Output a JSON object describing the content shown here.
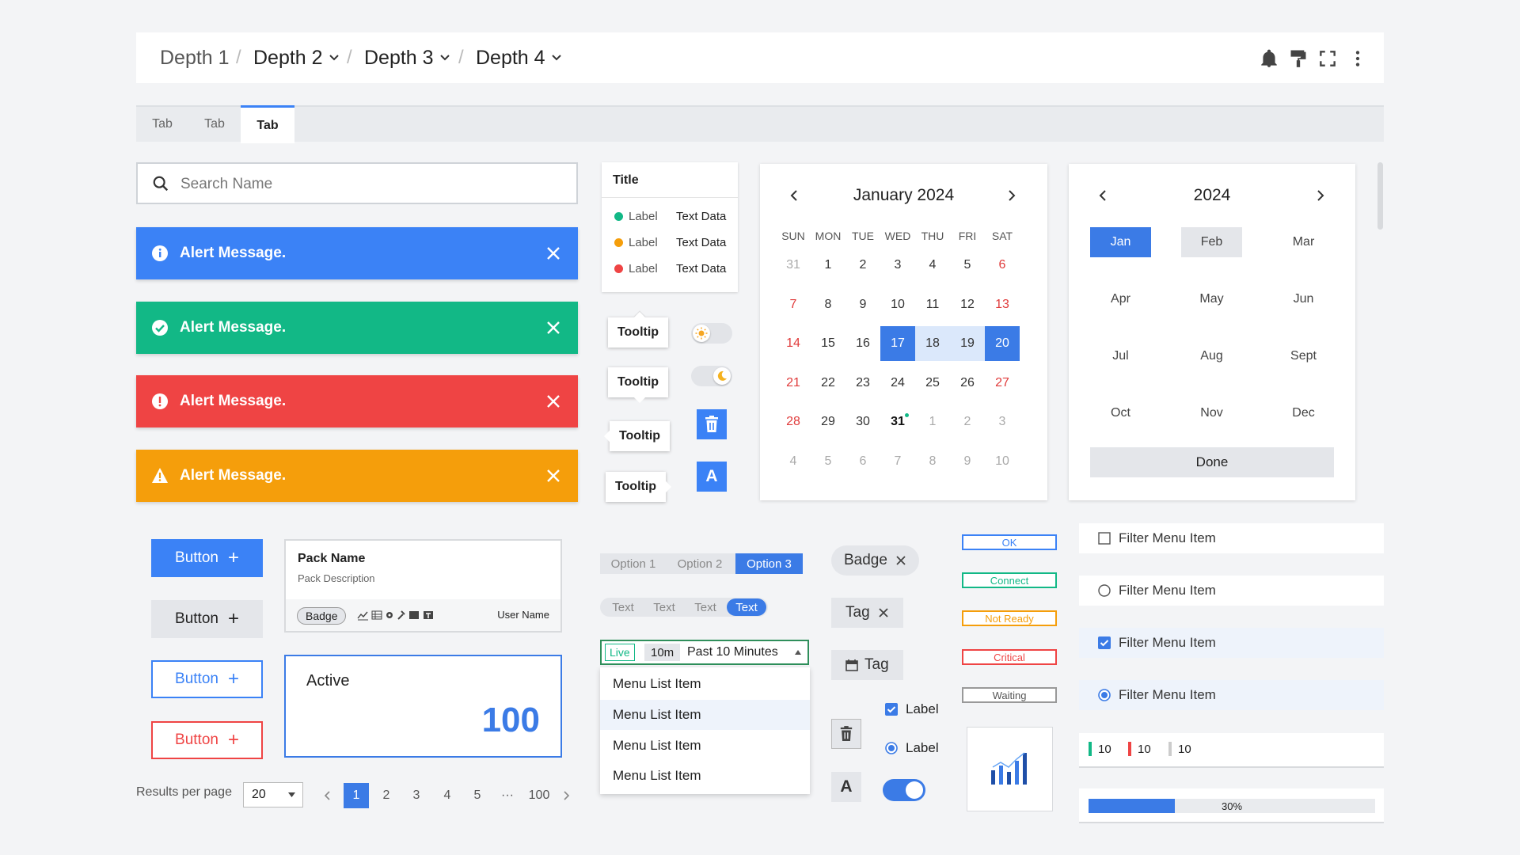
{
  "breadcrumb": {
    "items": [
      "Depth 1",
      "Depth 2",
      "Depth 3",
      "Depth 4"
    ],
    "separator": "/"
  },
  "header_icons": [
    "bell-icon",
    "paint-roller-icon",
    "fullscreen-icon",
    "more-vertical-icon"
  ],
  "tabs": [
    "Tab",
    "Tab",
    "Tab"
  ],
  "search": {
    "placeholder": "Search Name",
    "value": ""
  },
  "alerts": [
    {
      "text": "Alert Message.",
      "type": "info",
      "color": "#3b82f6"
    },
    {
      "text": "Alert Message.",
      "type": "success",
      "color": "#12b886"
    },
    {
      "text": "Alert Message.",
      "type": "error",
      "color": "#ef4444"
    },
    {
      "text": "Alert Message.",
      "type": "warning",
      "color": "#f59e0b"
    }
  ],
  "legend": {
    "title": "Title",
    "rows": [
      {
        "label": "Label",
        "value": "Text Data",
        "color": "#12b886"
      },
      {
        "label": "Label",
        "value": "Text Data",
        "color": "#f59e0b"
      },
      {
        "label": "Label",
        "value": "Text Data",
        "color": "#ef4444"
      }
    ]
  },
  "tooltips": [
    "Tooltip",
    "Tooltip",
    "Tooltip",
    "Tooltip"
  ],
  "icon_buttons": {
    "font_letter": "A"
  },
  "calendar": {
    "title": "January 2024",
    "weekdays": [
      "SUN",
      "MON",
      "TUE",
      "WED",
      "THU",
      "FRI",
      "SAT"
    ],
    "weeks": [
      [
        "31",
        "1",
        "2",
        "3",
        "4",
        "5",
        "6"
      ],
      [
        "7",
        "8",
        "9",
        "10",
        "11",
        "12",
        "13"
      ],
      [
        "14",
        "15",
        "16",
        "17",
        "18",
        "19",
        "20"
      ],
      [
        "21",
        "22",
        "23",
        "24",
        "25",
        "26",
        "27"
      ],
      [
        "28",
        "29",
        "30",
        "31",
        "1",
        "2",
        "3"
      ],
      [
        "4",
        "5",
        "6",
        "7",
        "8",
        "9",
        "10"
      ]
    ],
    "range_start": "17",
    "range_end": "20",
    "today": "31"
  },
  "month_picker": {
    "year": "2024",
    "months": [
      "Jan",
      "Feb",
      "Mar",
      "Apr",
      "May",
      "Jun",
      "Jul",
      "Aug",
      "Sept",
      "Oct",
      "Nov",
      "Dec"
    ],
    "selected": "Jan",
    "hovered": "Feb",
    "done_label": "Done"
  },
  "buttons": [
    "Button",
    "Button",
    "Button",
    "Button"
  ],
  "pack": {
    "name": "Pack Name",
    "description": "Pack Description",
    "badge": "Badge",
    "user": "User Name"
  },
  "active_card": {
    "label": "Active",
    "value": "100"
  },
  "pagination": {
    "results_label": "Results per page",
    "per_page": "20",
    "pages": [
      "1",
      "2",
      "3",
      "4",
      "5",
      "···",
      "100"
    ],
    "current": "1"
  },
  "segmented_options": {
    "items": [
      "Option 1",
      "Option 2",
      "Option 3"
    ],
    "selected": "Option 3"
  },
  "segmented_text": {
    "items": [
      "Text",
      "Text",
      "Text",
      "Text"
    ],
    "selected_index": 3
  },
  "time_select": {
    "live": "Live",
    "range": "10m",
    "label": "Past 10 Minutes"
  },
  "menu_items": [
    "Menu List Item",
    "Menu List Item",
    "Menu List Item",
    "Menu List Item"
  ],
  "chips": {
    "badge": "Badge",
    "tag": "Tag",
    "date_tag": "Tag"
  },
  "checks": {
    "checkbox_label": "Label",
    "radio_label": "Label"
  },
  "statuses": [
    {
      "text": "OK",
      "color": "#3b82f6"
    },
    {
      "text": "Connect",
      "color": "#12b886"
    },
    {
      "text": "Not Ready",
      "color": "#f59e0b"
    },
    {
      "text": "Critical",
      "color": "#ef4444"
    },
    {
      "text": "Waiting",
      "color": "#888888"
    }
  ],
  "filter_items": [
    {
      "label": "Filter Menu Item",
      "control": "checkbox",
      "checked": false
    },
    {
      "label": "Filter Menu Item",
      "control": "radio",
      "checked": false
    },
    {
      "label": "Filter Menu Item",
      "control": "checkbox",
      "checked": true
    },
    {
      "label": "Filter Menu Item",
      "control": "radio",
      "checked": true
    }
  ],
  "counts": [
    {
      "value": "10",
      "color": "#12b886"
    },
    {
      "value": "10",
      "color": "#ef4444"
    },
    {
      "value": "10",
      "color": "#cccccc"
    }
  ],
  "progress": {
    "value": 0.3,
    "label": "30%"
  }
}
